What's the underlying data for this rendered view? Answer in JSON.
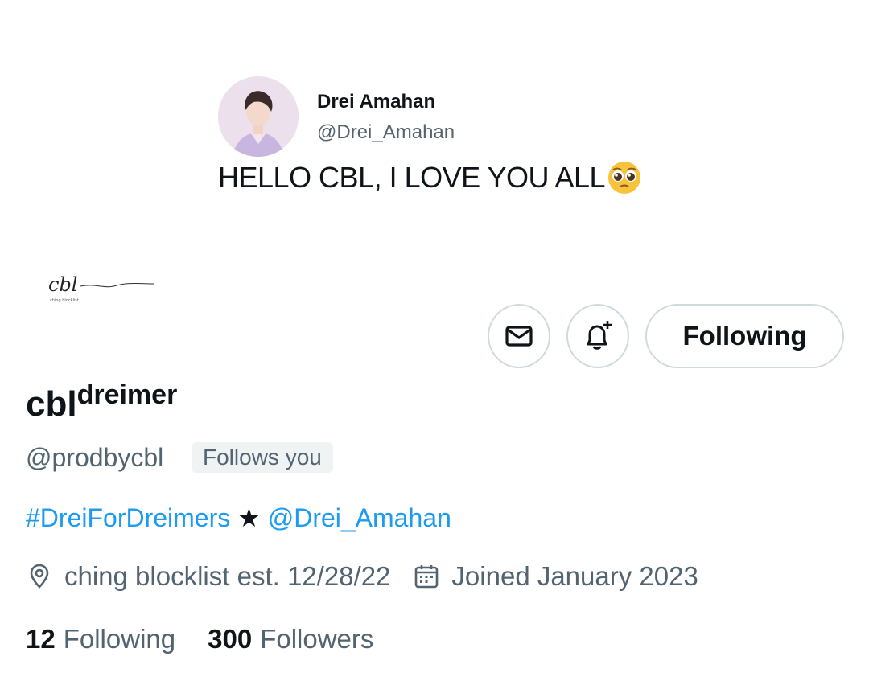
{
  "banner": {
    "tweet": {
      "author_name": "Drei Amahan",
      "author_handle": "@Drei_Amahan",
      "text": "HELLO CBL, I LOVE YOU ALL",
      "emoji": "pleading-face-emoji"
    }
  },
  "profile": {
    "logo_text": "cbl",
    "logo_subtext": "ching blocklist",
    "display_name": "cbl",
    "display_name_sup": "dreimer",
    "handle": "@prodbycbl",
    "follows_you": "Follows you",
    "bio": {
      "hashtag": "#DreiForDreimers",
      "star": "★",
      "mention": "@Drei_Amahan"
    },
    "location": "ching blocklist est. 12/28/22",
    "joined": "Joined January 2023",
    "following_count": "12",
    "following_label": "Following",
    "followers_count": "300",
    "followers_label": "Followers"
  },
  "actions": {
    "message_icon": "envelope-icon",
    "notify_icon": "bell-plus-icon",
    "follow_label": "Following"
  },
  "colors": {
    "link": "#1d9bf0",
    "muted": "#536471",
    "text": "#0f1419",
    "border": "#cfd9de",
    "badge_bg": "#eff3f4"
  }
}
